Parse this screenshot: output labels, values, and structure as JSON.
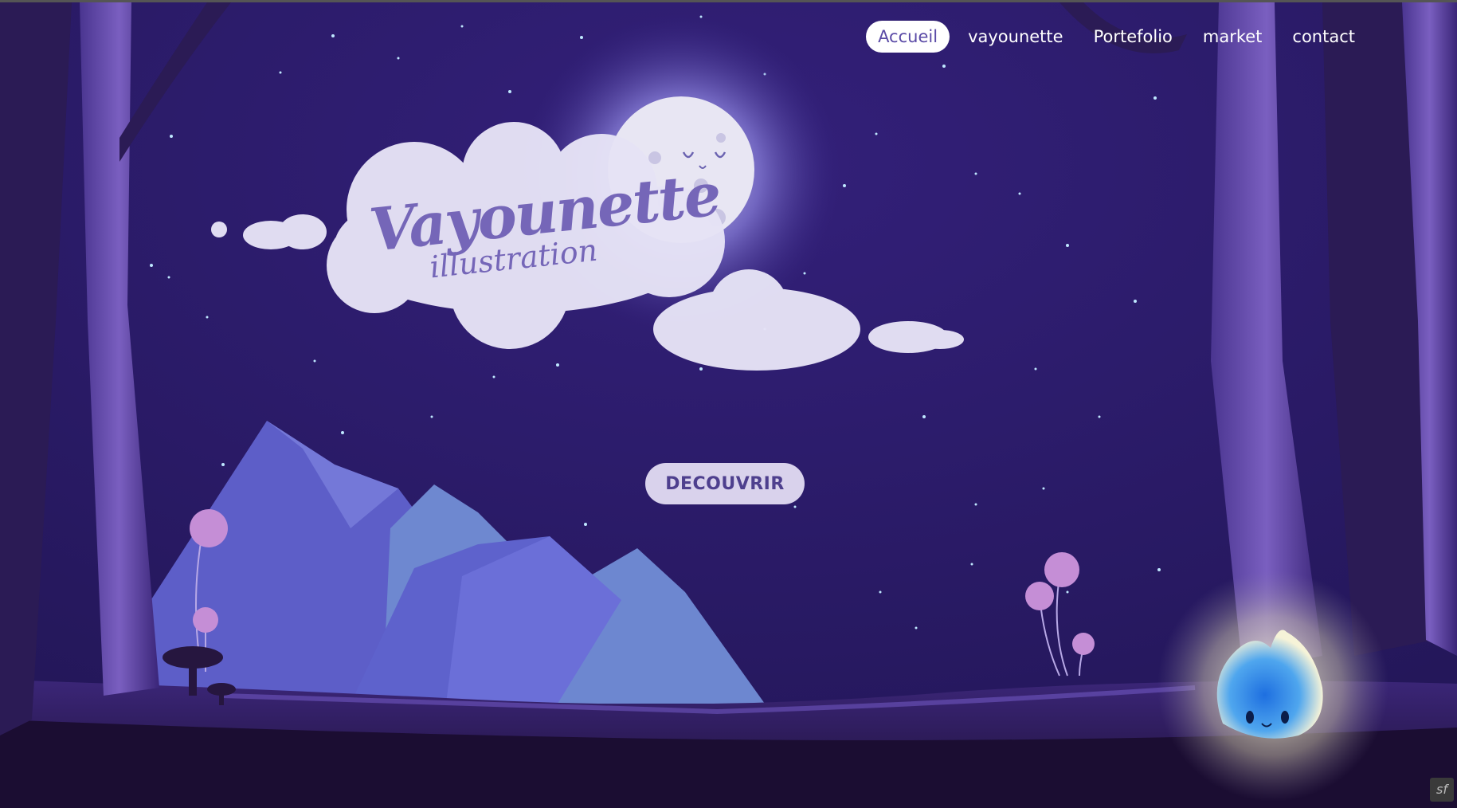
{
  "nav": {
    "items": [
      "Accueil",
      "vayounette",
      "Portefolio",
      "market",
      "contact"
    ],
    "active_index": 0
  },
  "hero": {
    "logo_title": "Vayounette",
    "logo_subtitle": "illustration",
    "cta_label": "DECOUVRIR"
  },
  "badge": {
    "text": "sf"
  },
  "colors": {
    "sky": "#2a1a5e",
    "mountain": "#5d63cc",
    "ground": "#24123f",
    "cta_bg": "#d9d2ec",
    "cta_text": "#4e3f8e",
    "nav_active_bg": "#ffffff",
    "nav_active_text": "#5a4aa6"
  },
  "icons": {
    "moon": "moon-icon",
    "spirit": "spirit-creature-icon",
    "framework": "symfony-icon"
  }
}
